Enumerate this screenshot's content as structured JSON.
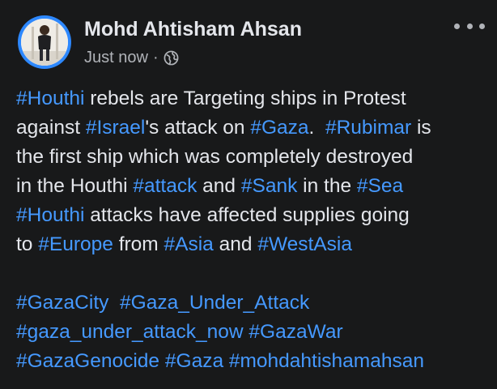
{
  "post": {
    "author": "Mohd Ahtisham Ahsan",
    "timestamp": "Just now",
    "separator": "·",
    "privacy_icon": "globe-icon",
    "more_icon": "more-options-icon",
    "lines": [
      [
        {
          "t": "#Houthi",
          "tag": true
        },
        {
          "t": " rebels are Targeting ships in Protest"
        }
      ],
      [
        {
          "t": "against "
        },
        {
          "t": "#Israel",
          "tag": true
        },
        {
          "t": "'s attack on "
        },
        {
          "t": "#Gaza",
          "tag": true
        },
        {
          "t": ".  "
        },
        {
          "t": "#Rubimar",
          "tag": true
        },
        {
          "t": " is"
        }
      ],
      [
        {
          "t": "the first ship which was completely destroyed"
        }
      ],
      [
        {
          "t": "in the Houthi "
        },
        {
          "t": "#attack",
          "tag": true
        },
        {
          "t": " and "
        },
        {
          "t": "#Sank",
          "tag": true
        },
        {
          "t": " in the "
        },
        {
          "t": "#Sea",
          "tag": true
        }
      ],
      [
        {
          "t": "#Houthi",
          "tag": true
        },
        {
          "t": " attacks have affected supplies going"
        }
      ],
      [
        {
          "t": "to "
        },
        {
          "t": "#Europe",
          "tag": true
        },
        {
          "t": " from "
        },
        {
          "t": "#Asia",
          "tag": true
        },
        {
          "t": " and "
        },
        {
          "t": "#WestAsia",
          "tag": true
        }
      ],
      [],
      [
        {
          "t": "#GazaCity",
          "tag": true
        },
        {
          "t": "  "
        },
        {
          "t": "#Gaza_Under_Attack",
          "tag": true
        }
      ],
      [
        {
          "t": "#gaza_under_attack_now",
          "tag": true
        },
        {
          "t": " "
        },
        {
          "t": "#GazaWar",
          "tag": true
        }
      ],
      [
        {
          "t": "#GazaGenocide",
          "tag": true
        },
        {
          "t": " "
        },
        {
          "t": "#Gaza",
          "tag": true
        },
        {
          "t": " "
        },
        {
          "t": "#mohdahtishamahsan",
          "tag": true
        }
      ]
    ]
  },
  "colors": {
    "background": "#18191a",
    "text": "#e4e6eb",
    "secondary_text": "#b0b3b8",
    "hashtag": "#4599ff",
    "story_ring": "#2d88ff"
  }
}
